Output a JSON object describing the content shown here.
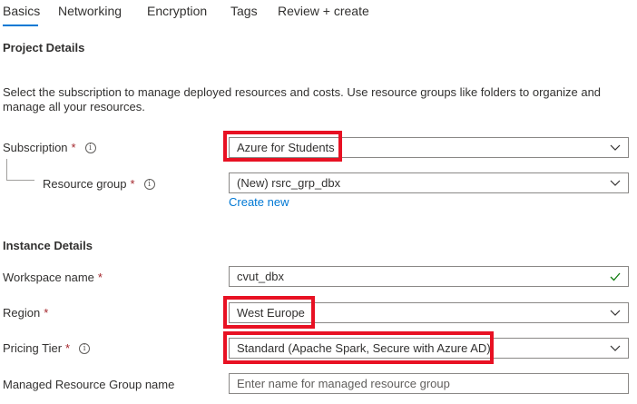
{
  "tabs": [
    {
      "label": "Basics",
      "active": true
    },
    {
      "label": "Networking"
    },
    {
      "label": "Encryption"
    },
    {
      "label": "Tags"
    },
    {
      "label": "Review + create"
    }
  ],
  "project_details": {
    "heading": "Project Details",
    "description": "Select the subscription to manage deployed resources and costs. Use resource groups like folders to organize and manage all your resources."
  },
  "subscription": {
    "label": "Subscription",
    "value": "Azure for Students",
    "required": "*",
    "info_icon": "i"
  },
  "resource_group": {
    "label": "Resource group",
    "value": "(New) rsrc_grp_dbx",
    "required": "*",
    "info_icon": "i",
    "create_new": "Create new"
  },
  "instance_details": {
    "heading": "Instance Details"
  },
  "workspace_name": {
    "label": "Workspace name",
    "value": "cvut_dbx",
    "required": "*"
  },
  "region": {
    "label": "Region",
    "value": "West Europe",
    "required": "*"
  },
  "pricing_tier": {
    "label": "Pricing Tier",
    "value": "Standard (Apache Spark, Secure with Azure AD)",
    "required": "*",
    "info_icon": "i"
  },
  "managed_rg": {
    "label": "Managed Resource Group name",
    "placeholder": "Enter name for managed resource group"
  },
  "colors": {
    "accent": "#0078d4",
    "highlight": "#e81123",
    "valid": "#107c10"
  }
}
